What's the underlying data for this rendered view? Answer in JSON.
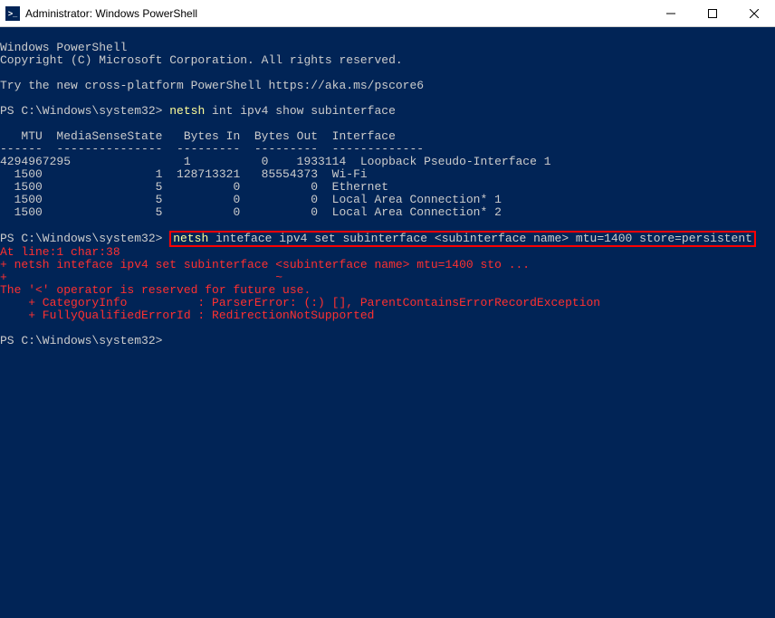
{
  "titlebar": {
    "icon_label": ">_",
    "title": "Administrator: Windows PowerShell"
  },
  "header": {
    "line1": "Windows PowerShell",
    "line2": "Copyright (C) Microsoft Corporation. All rights reserved.",
    "tip": "Try the new cross-platform PowerShell https://aka.ms/pscore6"
  },
  "prompt1": {
    "path": "PS C:\\Windows\\system32> ",
    "cmd_head": "netsh",
    "cmd_rest": " int ipv4 show subinterface"
  },
  "table": {
    "header": "   MTU  MediaSenseState   Bytes In  Bytes Out  Interface",
    "divider": "------  ---------------  ---------  ---------  -------------",
    "rows": [
      "4294967295                1          0    1933114  Loopback Pseudo-Interface 1",
      "  1500                1  128713321   85554373  Wi-Fi",
      "  1500                5          0          0  Ethernet",
      "  1500                5          0          0  Local Area Connection* 1",
      "  1500                5          0          0  Local Area Connection* 2"
    ]
  },
  "prompt2": {
    "path": "PS C:\\Windows\\system32> ",
    "cmd_head": "netsh",
    "cmd_rest": " inteface ipv4 set subinterface <subinterface name> mtu=1400 store=persistent"
  },
  "error": {
    "l1": "At line:1 char:38",
    "l2": "+ netsh inteface ipv4 set subinterface <subinterface name> mtu=1400 sto ...",
    "l3_pad": "+                                      ",
    "l3_tilde": "~",
    "l4": "The '<' operator is reserved for future use.",
    "l5": "    + CategoryInfo          : ParserError: (:) [], ParentContainsErrorRecordException",
    "l6": "    + FullyQualifiedErrorId : RedirectionNotSupported"
  },
  "prompt3": {
    "path": "PS C:\\Windows\\system32> "
  }
}
